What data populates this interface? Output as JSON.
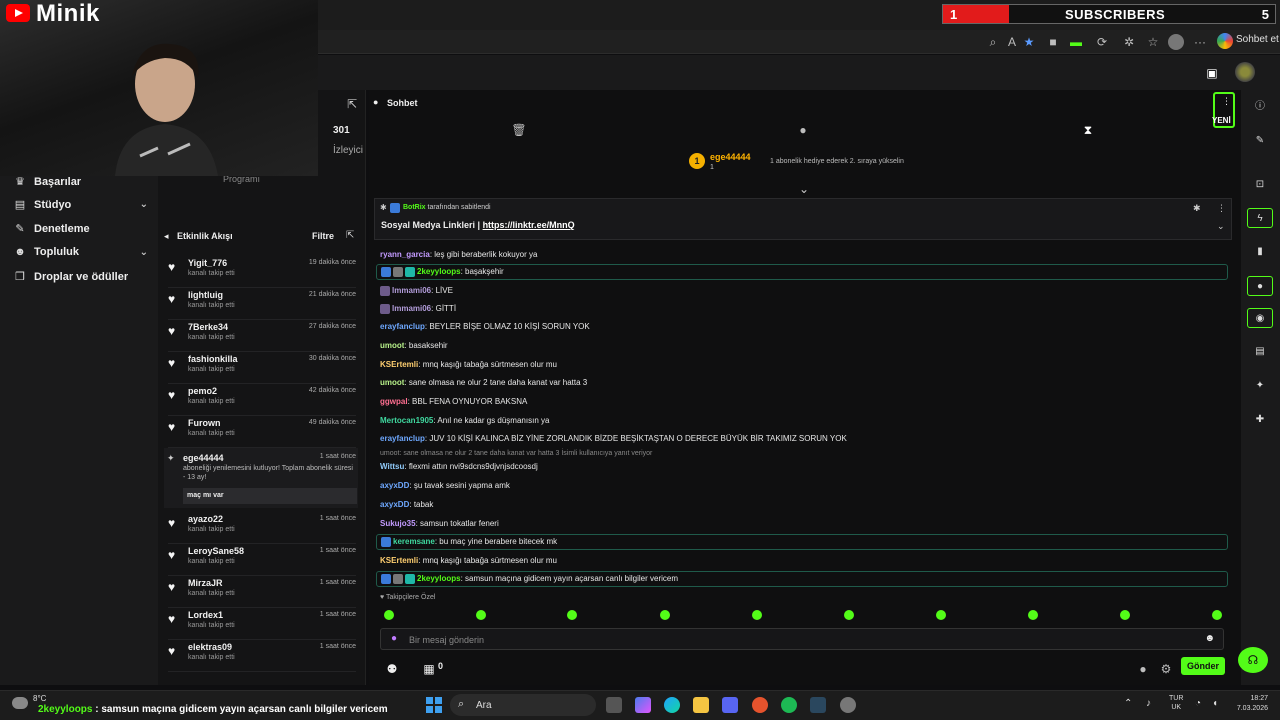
{
  "overlay": {
    "channel_name": "Minik",
    "subscriber_goal": {
      "current": "1",
      "label": "SUBSCRIBERS",
      "goal": "5",
      "progress_fraction": 0.2
    }
  },
  "browser": {
    "profile_label": "Sohbet et"
  },
  "sidebar": {
    "items": [
      {
        "label": "Başarılar",
        "icon": "trophy-icon",
        "expandable": false
      },
      {
        "label": "Stüdyo",
        "icon": "studio-icon",
        "expandable": true
      },
      {
        "label": "Denetleme",
        "icon": "wrench-icon",
        "expandable": false
      },
      {
        "label": "Topluluk",
        "icon": "community-icon",
        "expandable": true
      },
      {
        "label": "Droplar ve ödüller",
        "icon": "gift-icon",
        "expandable": false
      }
    ]
  },
  "stats": {
    "viewer_count": "301",
    "viewer_label": "İzleyici",
    "program_label": "Programı"
  },
  "activity": {
    "title": "Etkinlik Akışı",
    "filter_label": "Filtre",
    "follows_top": [
      {
        "user": "Yigit_776",
        "action": "kanalı takip etti",
        "time": "19 dakika önce"
      },
      {
        "user": "lightluig",
        "action": "kanalı takip etti",
        "time": "21 dakika önce"
      },
      {
        "user": "7Berke34",
        "action": "kanalı takip etti",
        "time": "27 dakika önce"
      },
      {
        "user": "fashionkilla",
        "action": "kanalı takip etti",
        "time": "30 dakika önce"
      },
      {
        "user": "pemo2",
        "action": "kanalı takip etti",
        "time": "42 dakika önce"
      },
      {
        "user": "Furown",
        "action": "kanalı takip etti",
        "time": "49 dakika önce"
      }
    ],
    "sub_event": {
      "user": "ege44444",
      "time": "1 saat önce",
      "text": "aboneliği yenilemesini kutluyor! Toplam abonelik süresi - 13 ay!",
      "message": "maç mı var"
    },
    "follows_bottom": [
      {
        "user": "ayazo22",
        "action": "kanalı takip etti",
        "time": "1 saat önce"
      },
      {
        "user": "LeroySane58",
        "action": "kanalı takip etti",
        "time": "1 saat önce"
      },
      {
        "user": "MirzaJR",
        "action": "kanalı takip etti",
        "time": "1 saat önce"
      },
      {
        "user": "Lordex1",
        "action": "kanalı takip etti",
        "time": "1 saat önce"
      },
      {
        "user": "elektras09",
        "action": "kanalı takip etti",
        "time": "1 saat önce"
      }
    ]
  },
  "chat": {
    "title": "Sohbet",
    "new_label": "YENİ",
    "gifter": {
      "rank": "1",
      "name": "ege44444",
      "count": "1",
      "text": "1 abonelik hediye ederek 2. sıraya yükselin"
    },
    "pinned": {
      "by_user": "BotRix",
      "by_suffix": "tarafından sabitlendi",
      "text": "Sosyal Medya Linkleri | ",
      "link": "https://linktr.ee/MnnQ"
    },
    "messages": [
      {
        "user": "ryann_garcia",
        "color": "#c39bff",
        "text": "leş gibi beraberlik kokuyor ya",
        "highlight": false
      },
      {
        "user": "2keyyloops",
        "color": "#53fc18",
        "text": "başakşehir",
        "highlight": true
      },
      {
        "user": "lmmami06",
        "color": "#b39ddb",
        "text": "LİVE",
        "highlight": false
      },
      {
        "user": "lmmami06",
        "color": "#b39ddb",
        "text": "GİTTİ",
        "highlight": false
      },
      {
        "user": "erayfanclup",
        "color": "#6ea8ff",
        "text": "BEYLER BİŞE OLMAZ 10 KİŞİ SORUN YOK",
        "highlight": false
      },
      {
        "user": "umoot",
        "color": "#b8f28a",
        "text": "basaksehir",
        "highlight": false
      },
      {
        "user": "KSErtemli",
        "color": "#ffcf70",
        "text": "mnq kaşığı tabağa sürtmesen olur mu",
        "highlight": false
      },
      {
        "user": "umoot",
        "color": "#b8f28a",
        "text": "sane olmasa ne olur 2 tane daha kanat var hatta 3",
        "highlight": false
      },
      {
        "user": "ggwpal",
        "color": "#ff6f91",
        "text": "BBL FENA OYNUYOR BAKSNA",
        "highlight": false
      },
      {
        "user": "Mertocan1905",
        "color": "#40d9a0",
        "text": "Anıl ne kadar gs düşmanısın ya",
        "highlight": false
      },
      {
        "user": "erayfanclup",
        "color": "#6ea8ff",
        "text": "JUV 10 KİŞİ KALINCA BİZ YİNE ZORLANDIK BİZDE BEŞİKTAŞTAN O DERECE BÜYÜK BİR TAKIMIZ SORUN YOK",
        "highlight": false
      },
      {
        "user": "Wittsu",
        "color": "#90caf9",
        "text": "flexmi attın nvi9sdcns9djvnjsdcoosdj",
        "highlight": false
      },
      {
        "user": "axyxDD",
        "color": "#6ea8ff",
        "text": "şu tavak sesini yapma amk",
        "highlight": false
      },
      {
        "user": "axyxDD",
        "color": "#6ea8ff",
        "text": "tabak",
        "highlight": false
      },
      {
        "user": "Sukujo35",
        "color": "#c39bff",
        "text": "samsun tokatlar feneri",
        "highlight": false
      },
      {
        "user": "keremsane",
        "color": "#40d9a0",
        "text": "bu maç yine berabere bitecek mk",
        "highlight": true
      },
      {
        "user": "KSErtemli",
        "color": "#ffcf70",
        "text": "mnq kaşığı tabağa sürtmesen olur mu",
        "highlight": false
      },
      {
        "user": "2keyyloops",
        "color": "#53fc18",
        "text": "samsun maçına gidicem yayın açarsan canlı bilgiler vericem",
        "highlight": true
      }
    ],
    "reply_hint": "umoot: sane olmasa ne olur 2 tane daha kanat var hatta 3 İsimli kullanıcıya yanıt veriyor",
    "followers_only_label": "Takipçilere Özel",
    "input_placeholder": "Bir mesaj gönderin",
    "points_value": "0",
    "send_label": "Gönder"
  },
  "taskbar": {
    "weather": "8°C",
    "ticker_user": "2keyyloops",
    "ticker_text": " : samsun maçına gidicem yayın açarsan canlı bilgiler vericem",
    "search_label": "Ara",
    "lang_line1": "TUR",
    "lang_line2": "UK",
    "time": "18:27",
    "date": "7.03.2026"
  }
}
